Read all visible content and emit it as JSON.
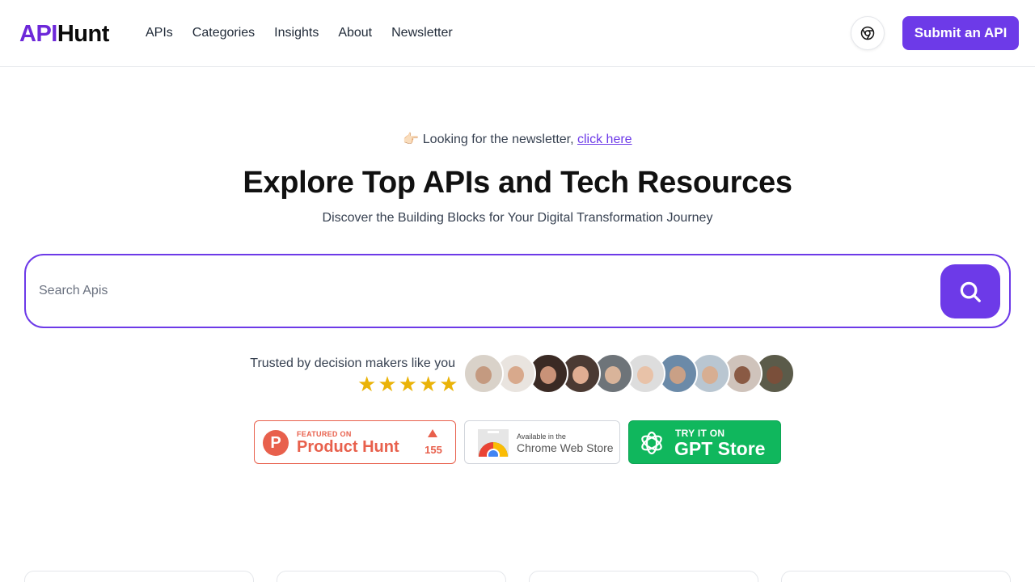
{
  "header": {
    "logo_api": "API",
    "logo_hunt": "Hunt",
    "nav": [
      "APIs",
      "Categories",
      "Insights",
      "About",
      "Newsletter"
    ],
    "chrome_icon": "chrome-icon",
    "submit_label": "Submit an API"
  },
  "hero": {
    "note_prefix": "👉🏻 Looking for the newsletter, ",
    "note_link": "click here",
    "title": "Explore Top APIs and Tech Resources",
    "subtitle": "Discover the Building Blocks for Your Digital Transformation Journey"
  },
  "search": {
    "placeholder": "Search Apis",
    "value": "",
    "button_icon": "search-icon"
  },
  "trust": {
    "text": "Trusted by decision makers like you",
    "rating": 5,
    "avatars": [
      {
        "bg": "#d9d2c9",
        "face": "#c49a80"
      },
      {
        "bg": "#e9e4df",
        "face": "#d8a98c"
      },
      {
        "bg": "#3a2a24",
        "face": "#c99278"
      },
      {
        "bg": "#4b3a33",
        "face": "#e0ad92"
      },
      {
        "bg": "#6e7479",
        "face": "#d9b49a"
      },
      {
        "bg": "#dddddd",
        "face": "#e8c2a8"
      },
      {
        "bg": "#6b8aa8",
        "face": "#c9a086"
      },
      {
        "bg": "#b9c6d1",
        "face": "#d7ae92"
      },
      {
        "bg": "#cfc3bb",
        "face": "#8a5a44"
      },
      {
        "bg": "#5b5b4a",
        "face": "#7a4f3a"
      }
    ]
  },
  "badges": {
    "producthunt": {
      "featured": "FEATURED ON",
      "name": "Product Hunt",
      "count": "155",
      "color": "#e8604c"
    },
    "chrome": {
      "available": "Available in the",
      "store": "Chrome Web Store"
    },
    "gpt": {
      "try": "TRY IT ON",
      "store": "GPT Store",
      "color": "#10b75d"
    }
  },
  "colors": {
    "accent": "#6d3ae8",
    "logo_purple": "#6d28d9",
    "star": "#eab308"
  }
}
